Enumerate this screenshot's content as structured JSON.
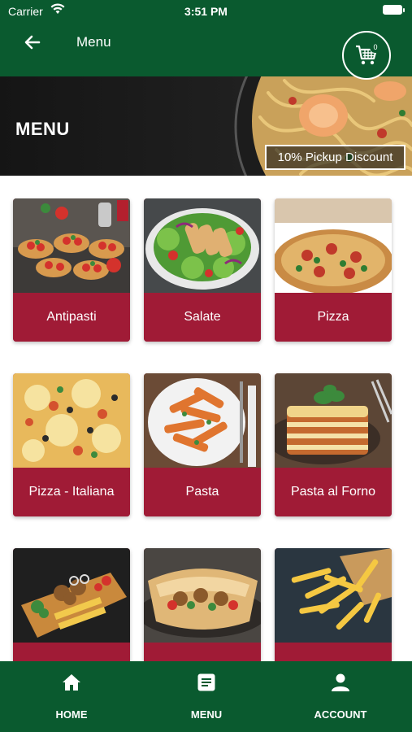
{
  "status_bar": {
    "carrier": "Carrier",
    "time": "3:51 PM"
  },
  "app_bar": {
    "title": "Menu",
    "cart_count": "0"
  },
  "hero": {
    "title": "MENU",
    "badge": "10% Pickup Discount"
  },
  "categories": [
    {
      "label": "Antipasti"
    },
    {
      "label": "Salate"
    },
    {
      "label": "Pizza"
    },
    {
      "label": "Pizza - Italiana"
    },
    {
      "label": "Pasta"
    },
    {
      "label": "Pasta al Forno"
    },
    {
      "label": ""
    },
    {
      "label": ""
    },
    {
      "label": ""
    }
  ],
  "bottom_nav": {
    "items": [
      {
        "label": "HOME",
        "icon": "home-icon"
      },
      {
        "label": "MENU",
        "icon": "menu-list-icon"
      },
      {
        "label": "ACCOUNT",
        "icon": "account-icon"
      }
    ]
  },
  "colors": {
    "brand_green": "#0a5a2f",
    "card_red": "#a01b36"
  }
}
